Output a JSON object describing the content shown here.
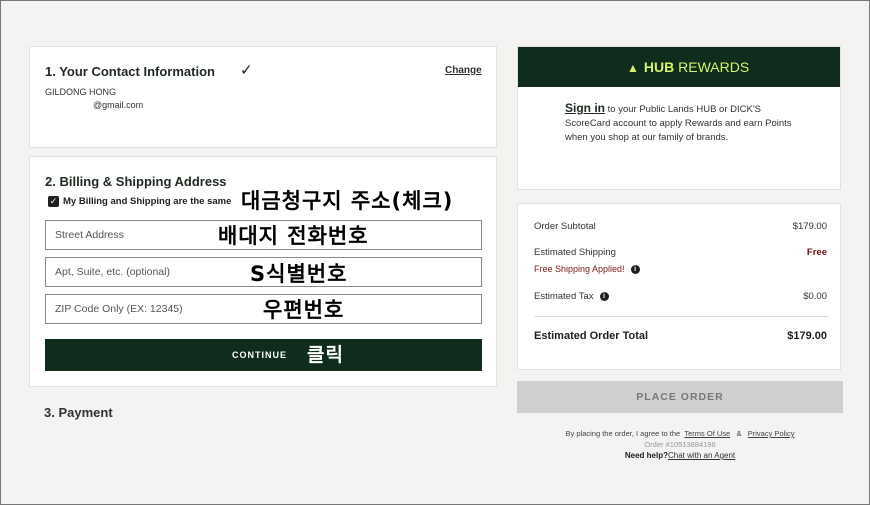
{
  "contact": {
    "title": "1. Your Contact Information",
    "change_label": "Change",
    "name": "GILDONG HONG",
    "email": "@gmail.com"
  },
  "billing": {
    "title": "2. Billing & Shipping Address",
    "same_label": "My Billing and Shipping are the same",
    "same_checked": true,
    "street_placeholder": "Street Address",
    "apt_placeholder": "Apt, Suite, etc. (optional)",
    "zip_placeholder": "ZIP Code Only (EX: 12345)",
    "continue_label": "CONTINUE"
  },
  "annotations": {
    "billing": "대금청구지 주소(체크)",
    "street": "배대지 전화번호",
    "apt": "S식별번호",
    "zip": "우편번호",
    "continue": "클릭"
  },
  "payment": {
    "title": "3. Payment"
  },
  "rewards": {
    "logo_bold": "HUB",
    "logo_rest": " REWARDS",
    "signin_label": "Sign in",
    "text": " to your Public Lands HUB or DICK'S ScoreCard account to apply Rewards and earn Points when you shop at our family of brands."
  },
  "summary": {
    "subtotal_label": "Order Subtotal",
    "subtotal_value": "$179.00",
    "shipping_label": "Estimated Shipping",
    "shipping_value": "Free",
    "free_applied": "Free Shipping Applied!",
    "tax_label": "Estimated Tax",
    "tax_value": "$0.00",
    "total_label": "Estimated Order Total",
    "total_value": "$179.00"
  },
  "place_order_label": "PLACE ORDER",
  "legal": {
    "prefix": "By placing the order, I agree to the",
    "terms": "Terms Of Use",
    "amp": "&",
    "privacy": "Privacy Policy",
    "order_number": "Order #10513884196",
    "help_label": "Need help?",
    "chat": "Chat with an Agent"
  },
  "colors": {
    "brand_dark_green": "#0f2c1d",
    "rewards_lime": "#d5f26b",
    "free_red": "#6b0f17"
  }
}
